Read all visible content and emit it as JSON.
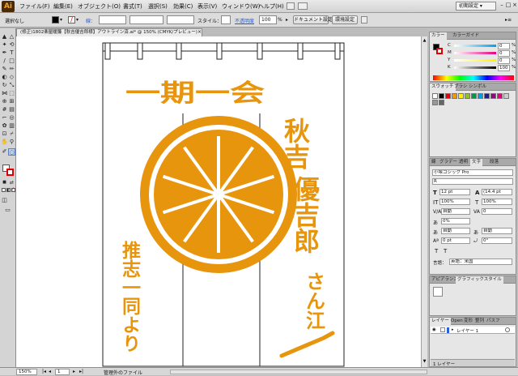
{
  "app": {
    "logo": "Ai"
  },
  "menubar": {
    "items": [
      "ファイル(F)",
      "編集(E)",
      "オブジェクト(O)",
      "書式(T)",
      "選択(S)",
      "効果(C)",
      "表示(V)",
      "ウィンドウ(W)",
      "ヘルプ(H)"
    ],
    "workspace": "初期設定 ▾"
  },
  "controlbar": {
    "selection_label": "選択なし",
    "stroke_label": "線：",
    "style_label": "スタイル：",
    "opacity_link": "不透明度",
    "opacity_value": "100",
    "opacity_unit": "%",
    "doc_setup_button": "ドキュメント設定",
    "prefs_button": "環境設定"
  },
  "document": {
    "tab_title": "(修正)1802楽屋暖簾【秋吉優吉郎様】アウトライン済.ai* @ 150% (CMYK/プレビュー)"
  },
  "artwork": {
    "top_title": "一期一会",
    "right_name_1": "秋吉",
    "right_name_2": "優吉郎",
    "right_honorific": "さん江",
    "left_sender": "推志一同より"
  },
  "statusbar": {
    "zoom": "150%",
    "page": "1",
    "info": "管理外のファイル"
  },
  "panels": {
    "color": {
      "tabs": [
        "カラー",
        "カラーガイド"
      ],
      "channels": [
        {
          "label": "C",
          "value": "0"
        },
        {
          "label": "M",
          "value": "0"
        },
        {
          "label": "Y",
          "value": "0"
        },
        {
          "label": "K",
          "value": "100"
        }
      ],
      "unit": "%"
    },
    "swatches": {
      "tabs": [
        "スウォッチ",
        "ブラシ",
        "シンボル"
      ]
    },
    "character": {
      "tabs": [
        "線",
        "グラデー",
        "透明",
        "文字",
        "段落"
      ],
      "font_family": "小塚ゴシック Pro",
      "font_style": "R",
      "font_size": "12 pt",
      "leading": "(14.4 pt",
      "vscale": "100%",
      "hscale": "100%",
      "kerning": "自動",
      "tracking": "0",
      "tsume": "0%",
      "aki_left": "自動",
      "aki_right": "自動",
      "baseline": "0 pt",
      "rotation": "0°",
      "language_label": "言語：",
      "language": "英語：米国"
    },
    "appearance": {
      "tabs": [
        "アピアランス",
        "グラフィックスタイル"
      ]
    },
    "layers": {
      "tabs": [
        "レイヤー",
        "Open",
        "変形",
        "整列",
        "パスフ"
      ],
      "layer_name": "レイヤー 1",
      "footer": "1 レイヤー"
    }
  },
  "colors": {
    "artwork_orange": "#e8950e",
    "accent_blue": "#2a5fd8"
  }
}
